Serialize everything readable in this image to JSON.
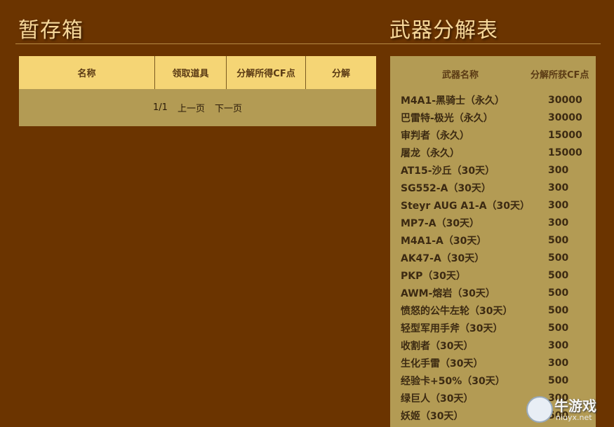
{
  "storage": {
    "title": "暂存箱",
    "columns": [
      "名称",
      "领取道具",
      "分解所得CF点",
      "分解"
    ],
    "pager": {
      "page": "1/1",
      "prev": "上一页",
      "next": "下一页"
    }
  },
  "weapon_table": {
    "title": "武器分解表",
    "headers": {
      "name": "武器名称",
      "cf": "分解所获CF点"
    },
    "rows": [
      {
        "name": "M4A1-黑骑士（永久）",
        "cf": "30000"
      },
      {
        "name": "巴雷特-极光（永久）",
        "cf": "30000"
      },
      {
        "name": "审判者（永久）",
        "cf": "15000"
      },
      {
        "name": "屠龙（永久）",
        "cf": "15000"
      },
      {
        "name": "AT15-沙丘（30天）",
        "cf": "300"
      },
      {
        "name": "SG552-A（30天）",
        "cf": "300"
      },
      {
        "name": "Steyr AUG A1-A（30天）",
        "cf": "300"
      },
      {
        "name": "MP7-A（30天）",
        "cf": "300"
      },
      {
        "name": "M4A1-A（30天）",
        "cf": "500"
      },
      {
        "name": "AK47-A（30天）",
        "cf": "500"
      },
      {
        "name": "PKP（30天）",
        "cf": "500"
      },
      {
        "name": "AWM-熔岩（30天）",
        "cf": "500"
      },
      {
        "name": "愤怒的公牛左轮（30天）",
        "cf": "500"
      },
      {
        "name": "轻型军用手斧（30天）",
        "cf": "500"
      },
      {
        "name": "收割者（30天）",
        "cf": "300"
      },
      {
        "name": "生化手雷（30天）",
        "cf": "300"
      },
      {
        "name": "经验卡+50%（30天）",
        "cf": "500"
      },
      {
        "name": "绿巨人（30天）",
        "cf": "300"
      },
      {
        "name": "妖姬（30天）",
        "cf": "500"
      }
    ]
  },
  "watermark": {
    "text": "牛游戏",
    "url": "niuyx.net"
  },
  "colors": {
    "background": "#6b3400",
    "header": "#f5d575",
    "panel": "#b39b54",
    "title": "#f6d79a"
  }
}
